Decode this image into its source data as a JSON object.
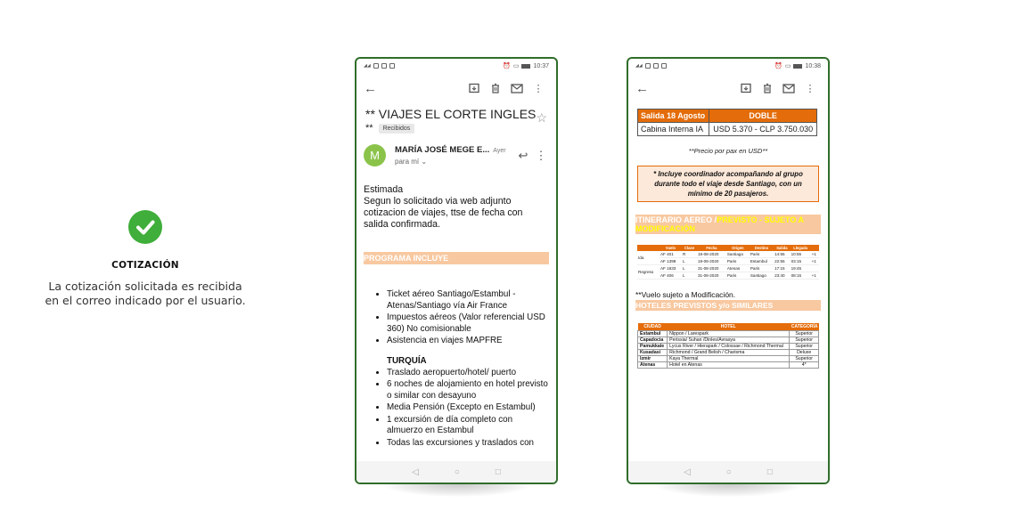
{
  "info": {
    "title": "COTIZACIÓN",
    "description_lines": [
      "La cotización solicitada es recibida",
      "en el correo indicado por el usuario."
    ]
  },
  "phone1": {
    "status_time": "10:37",
    "subject": "** VIAJES EL CORTE INGLES",
    "subject_prefix": "**",
    "label": "Recibidos",
    "sender_initial": "M",
    "sender_name": "MARÍA JOSÉ MEGE E...",
    "sender_when": "Ayer",
    "sender_to": "para mí",
    "body_lines": [
      "Estimada",
      "Segun lo solicitado via web adjunto",
      "cotizacion de viajes, ttse de fecha con",
      "salida confirmada."
    ],
    "band_title": "PROGRAMA INCLUYE",
    "includes": [
      "Ticket aéreo Santiago/Estambul - Atenas/Santiago vía Air France",
      "Impuestos aéreos (Valor referencial USD 360) No comisionable",
      "Asistencia  en viajes MAPFRE"
    ],
    "turquia_title": "TURQUÍA",
    "turquia_items": [
      "Traslado aeropuerto/hotel/ puerto",
      "6 noches de alojamiento  en hotel previsto o similar con desayuno",
      "Media Pensión (Excepto en Estambul)",
      "1 excursión de día completo con almuerzo en Estambul",
      "Todas las excursiones y traslados con"
    ]
  },
  "phone2": {
    "status_time": "10:38",
    "table_head": [
      "Salida 18 Agosto",
      "DOBLE"
    ],
    "table_row": [
      "Cabina Interna IA",
      "USD 5.370 - CLP 3.750.030"
    ],
    "price_note": "**Precio por pax en USD**",
    "coord_note": "* Incluye coordinador acompañando al grupo durante todo el viaje desde Santiago, con un mínimo de 20 pasajeros.",
    "itin_title_white": "ITINERARIO AEREO /",
    "itin_title_yellow": "PREVISTO - SUJETO A MODIFICACIÓN",
    "flight_headers": [
      "Vuelo",
      "Clase",
      "Fecha",
      "Origen",
      "Destino",
      "Salida",
      "Llegada"
    ],
    "flights": [
      {
        "group": "Ida",
        "vuelo": "AF 401",
        "clase": "R",
        "fecha": "18-08-2020",
        "origen": "Santiago",
        "destino": "Paris",
        "salida": "14:55",
        "llegada": "10:55",
        "dias": "+1"
      },
      {
        "group": "",
        "vuelo": "AF 1398",
        "clase": "L",
        "fecha": "19-08-2020",
        "origen": "Paris",
        "destino": "Estambul",
        "salida": "22:55",
        "llegada": "03:15",
        "dias": "+1"
      },
      {
        "group": "Regreso",
        "vuelo": "AF 1833",
        "clase": "L",
        "fecha": "31-08-2020",
        "origen": "Atenas",
        "destino": "Paris",
        "salida": "17:15",
        "llegada": "19:45",
        "dias": ""
      },
      {
        "group": "",
        "vuelo": "AF 406",
        "clase": "L",
        "fecha": "31-08-2020",
        "origen": "Paris",
        "destino": "Santiago",
        "salida": "23:40",
        "llegada": "08:15",
        "dias": "+1"
      }
    ],
    "vuelo_note": "**Vuelo sujeto a Modificación.",
    "hotel_title": "HOTELES PREVISTOS y/o SIMILARES",
    "hotel_headers": [
      "CIUDAD",
      "HOTEL",
      "CATEGORÍA"
    ],
    "hotels": [
      {
        "ciudad": "Estambul",
        "hotel": "Nippon / Larespark",
        "cat": "Superior"
      },
      {
        "ciudad": "Capadocia",
        "hotel": "Perissia/ Suhan /Dinles/Avrasya",
        "cat": "Superior"
      },
      {
        "ciudad": "Pamukkale",
        "hotel": "Lycus River / Hierapark / Colossae / Richmond Thermal",
        "cat": "Superior"
      },
      {
        "ciudad": "Kusadasi",
        "hotel": "Richmond / Grand Belish / Charisma",
        "cat": "Deluxe"
      },
      {
        "ciudad": "Izmir",
        "hotel": "Kaya Thermal",
        "cat": "Superior"
      },
      {
        "ciudad": "Atenas",
        "hotel": "Hotel en Atenas",
        "cat": "4*"
      }
    ]
  }
}
